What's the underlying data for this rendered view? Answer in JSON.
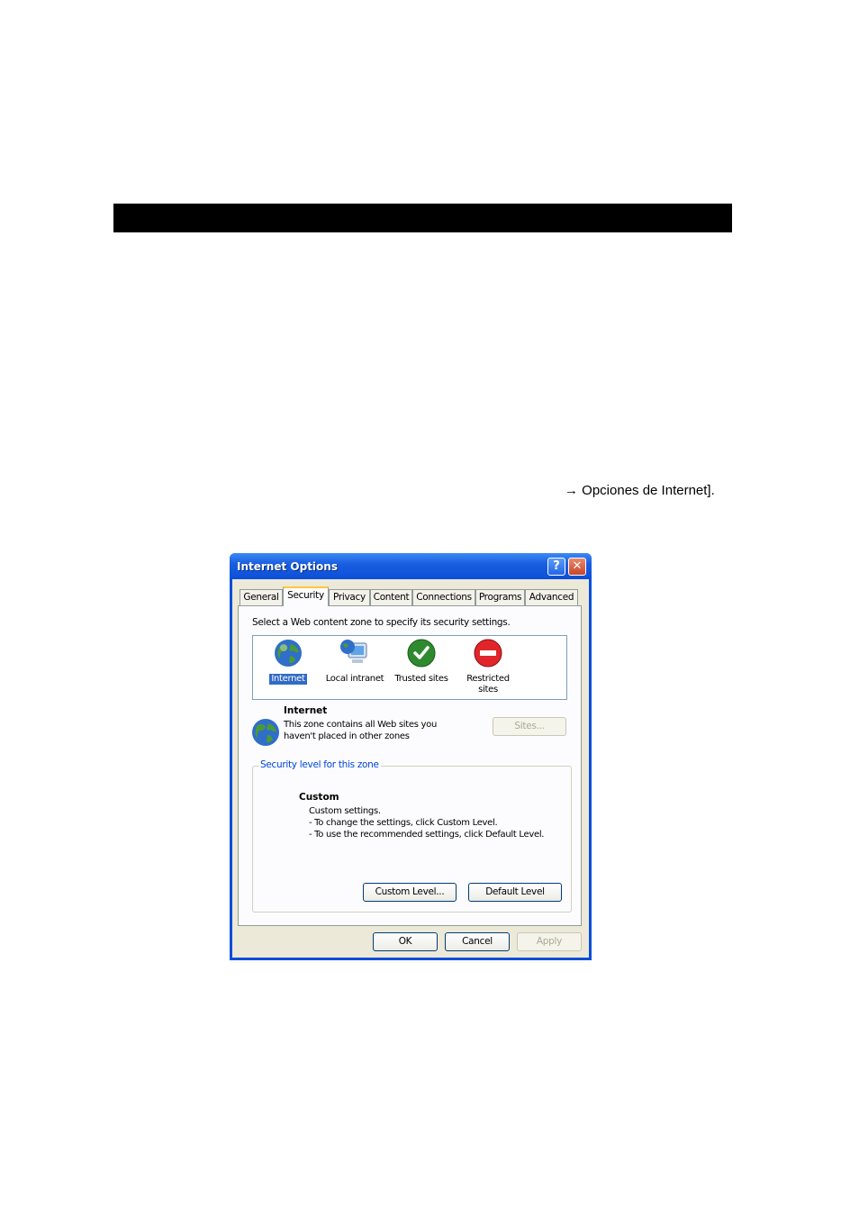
{
  "document": {
    "heading_bar": "",
    "breadcrumb_tail": "→ Opciones de Internet]."
  },
  "dialog": {
    "title": "Internet Options",
    "help_glyph": "?",
    "close_glyph": "✕",
    "tabs": [
      {
        "label": "General"
      },
      {
        "label": "Security",
        "active": true
      },
      {
        "label": "Privacy"
      },
      {
        "label": "Content"
      },
      {
        "label": "Connections"
      },
      {
        "label": "Programs"
      },
      {
        "label": "Advanced"
      }
    ],
    "instruction": "Select a Web content zone to specify its security settings.",
    "zones": [
      {
        "label_line1": "Internet",
        "label_line2": "",
        "icon": "globe-icon",
        "selected": true
      },
      {
        "label_line1": "Local intranet",
        "label_line2": "",
        "icon": "computer-globe-icon"
      },
      {
        "label_line1": "Trusted sites",
        "label_line2": "",
        "icon": "checkmark-icon"
      },
      {
        "label_line1": "Restricted",
        "label_line2": "sites",
        "icon": "no-entry-icon"
      }
    ],
    "zone_info": {
      "name": "Internet",
      "desc_line1": "This zone contains all Web sites you",
      "desc_line2": "haven't placed in other zones",
      "sites_button": "Sites..."
    },
    "security_level": {
      "group_label": "Security level for this zone",
      "level_name": "Custom",
      "line1": "Custom settings.",
      "line2": "- To change the settings, click Custom Level.",
      "line3": "- To use the recommended settings, click Default Level.",
      "custom_button": "Custom Level...",
      "default_button": "Default Level"
    },
    "footer": {
      "ok": "OK",
      "cancel": "Cancel",
      "apply": "Apply"
    }
  }
}
